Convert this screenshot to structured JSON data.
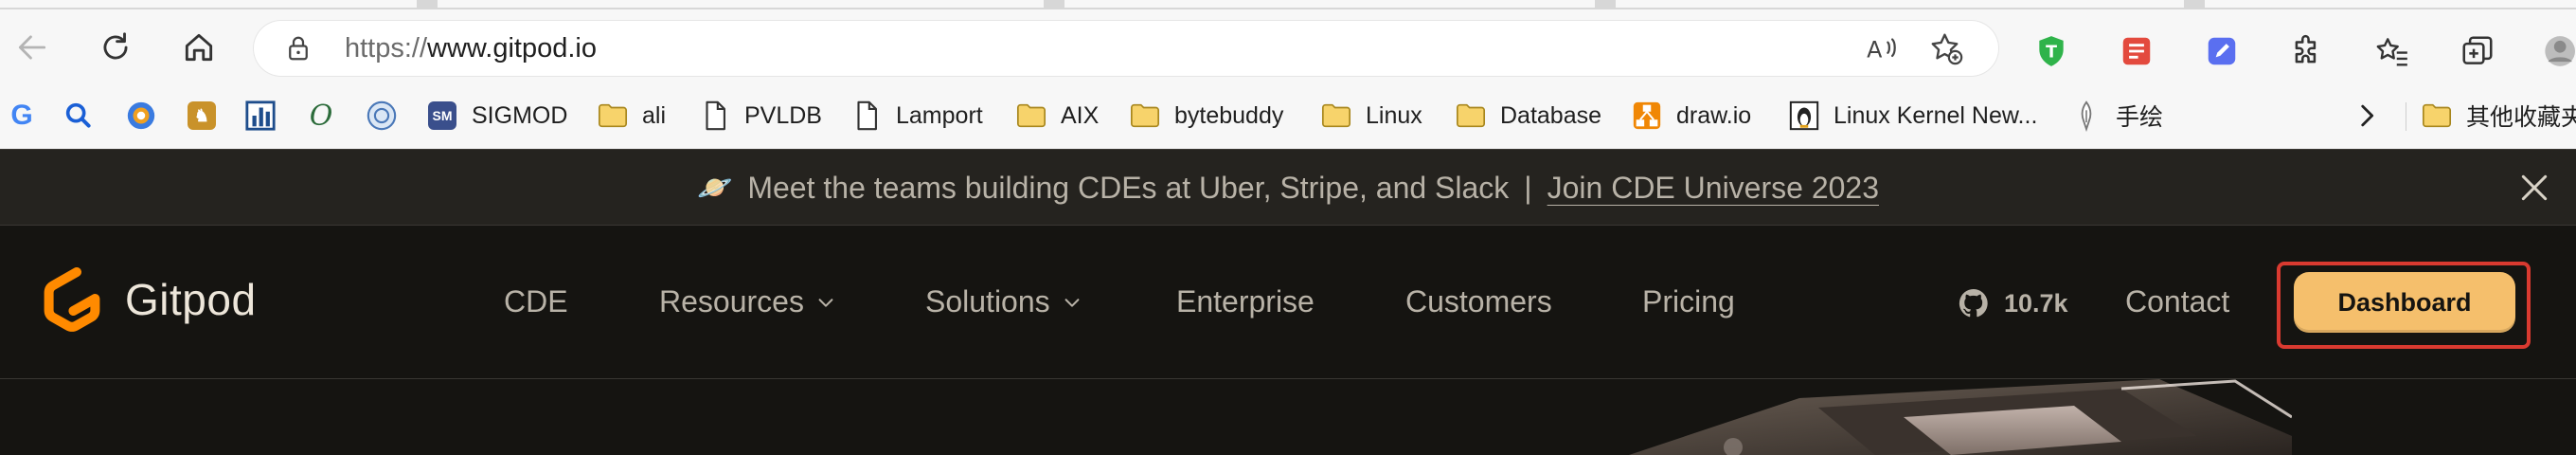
{
  "browser": {
    "url_scheme": "https://",
    "url_host": "www.gitpod.io",
    "icons": {
      "back": "back-arrow-icon",
      "reload": "reload-icon",
      "home": "home-icon",
      "lock": "lock-icon",
      "read_aloud": "read-aloud-icon",
      "favorite": "add-favorite-icon",
      "extensions": [
        "tampermonkey-icon",
        "notes-extension-icon",
        "pen-extension-icon",
        "puzzle-icon",
        "favorites-icon",
        "collections-icon",
        "profile-avatar"
      ]
    },
    "bookmarks": [
      {
        "label": "",
        "icon": "google-icon"
      },
      {
        "label": "",
        "icon": "search-icon"
      },
      {
        "label": "",
        "icon": "scholar-icon"
      },
      {
        "label": "",
        "icon": "site-icon"
      },
      {
        "label": "",
        "icon": "chart-icon"
      },
      {
        "label": "",
        "icon": "omega-icon"
      },
      {
        "label": "",
        "icon": "seal-icon"
      },
      {
        "label": "SIGMOD",
        "icon": "sigmod-icon"
      },
      {
        "label": "ali",
        "icon": "folder-icon"
      },
      {
        "label": "PVLDB",
        "icon": "page-icon"
      },
      {
        "label": "Lamport",
        "icon": "page-icon"
      },
      {
        "label": "AIX",
        "icon": "folder-icon"
      },
      {
        "label": "bytebuddy",
        "icon": "folder-icon"
      },
      {
        "label": "Linux",
        "icon": "folder-icon"
      },
      {
        "label": "Database",
        "icon": "folder-icon"
      },
      {
        "label": "draw.io",
        "icon": "drawio-icon"
      },
      {
        "label": "Linux Kernel New...",
        "icon": "tux-icon"
      },
      {
        "label": "手绘",
        "icon": "pen-nib-icon"
      },
      {
        "label": "",
        "icon": "chevron-right-icon"
      },
      {
        "label": "其他收藏夹",
        "icon": "folder-icon"
      }
    ]
  },
  "announcement": {
    "emoji": "🪐",
    "text": "Meet the teams building CDEs at Uber, Stripe, and Slack",
    "separator": "|",
    "link": "Join CDE Universe 2023"
  },
  "header": {
    "logo_text": "Gitpod",
    "nav": [
      {
        "label": "CDE",
        "has_dropdown": false
      },
      {
        "label": "Resources",
        "has_dropdown": true
      },
      {
        "label": "Solutions",
        "has_dropdown": true
      },
      {
        "label": "Enterprise",
        "has_dropdown": false
      },
      {
        "label": "Customers",
        "has_dropdown": false
      },
      {
        "label": "Pricing",
        "has_dropdown": false
      }
    ],
    "github_stars": "10.7k",
    "contact": "Contact",
    "dashboard": "Dashboard"
  },
  "colors": {
    "page_bg": "#151411",
    "banner_bg": "#25231f",
    "text_muted": "#b8b2a7",
    "brand_orange": "#ff8a00",
    "dashboard_bg": "#f5bf6c",
    "highlight_red": "#d93a30"
  }
}
